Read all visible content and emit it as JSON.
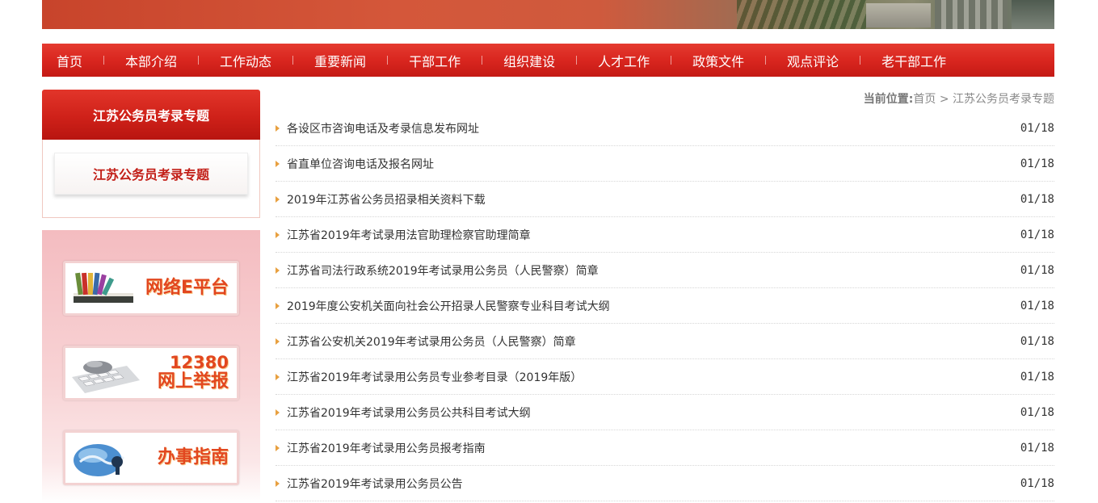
{
  "nav": {
    "items": [
      "首页",
      "本部介绍",
      "工作动态",
      "重要新闻",
      "干部工作",
      "组织建设",
      "人才工作",
      "政策文件",
      "观点评论",
      "老干部工作"
    ]
  },
  "sidebar": {
    "title": "江苏公务员考录专题",
    "sub_button": "江苏公务员考录专题",
    "promos": [
      {
        "label": "网络E平台",
        "icon": "books-icon"
      },
      {
        "label_num": "12380",
        "label": "网上举报",
        "icon": "keyboard-icon"
      },
      {
        "label": "办事指南",
        "icon": "globe-icon"
      }
    ]
  },
  "breadcrumb": {
    "prefix": "当前位置:",
    "home": "首页",
    "sep": ">",
    "current": "江苏公务员考录专题"
  },
  "list": [
    {
      "title": "各设区市咨询电话及考录信息发布网址",
      "date": "01/18"
    },
    {
      "title": "省直单位咨询电话及报名网址",
      "date": "01/18"
    },
    {
      "title": "2019年江苏省公务员招录相关资料下载",
      "date": "01/18"
    },
    {
      "title": "江苏省2019年考试录用法官助理检察官助理简章",
      "date": "01/18"
    },
    {
      "title": "江苏省司法行政系统2019年考试录用公务员（人民警察）简章",
      "date": "01/18"
    },
    {
      "title": "2019年度公安机关面向社会公开招录人民警察专业科目考试大纲",
      "date": "01/18"
    },
    {
      "title": "江苏省公安机关2019年考试录用公务员（人民警察）简章",
      "date": "01/18"
    },
    {
      "title": "江苏省2019年考试录用公务员专业参考目录（2019年版）",
      "date": "01/18"
    },
    {
      "title": "江苏省2019年考试录用公务员公共科目考试大纲",
      "date": "01/18"
    },
    {
      "title": "江苏省2019年考试录用公务员报考指南",
      "date": "01/18"
    },
    {
      "title": "江苏省2019年考试录用公务员公告",
      "date": "01/18"
    }
  ],
  "colors": {
    "accent": "#d9261f",
    "bullet": "#e8a040",
    "promo_text": "#e2471f"
  }
}
